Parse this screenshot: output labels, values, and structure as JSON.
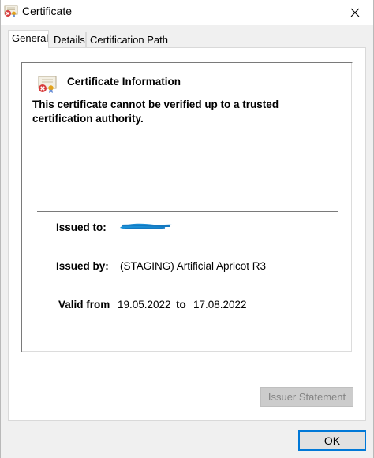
{
  "window": {
    "title": "Certificate",
    "close_symbol": "✕"
  },
  "tabs": [
    {
      "label": "General"
    },
    {
      "label": "Details"
    },
    {
      "label": "Certification Path"
    }
  ],
  "info": {
    "heading": "Certificate Information",
    "warning": "This certificate cannot be verified up to a trusted certification authority.",
    "issued_to_label": "Issued to:",
    "issued_by_label": "Issued by:",
    "issued_by_value": "(STAGING) Artificial Apricot R3",
    "valid_from_label": "Valid from",
    "valid_from_value": "19.05.2022",
    "to_label": "to",
    "valid_to_value": "17.08.2022"
  },
  "buttons": {
    "issuer_statement": "Issuer Statement",
    "ok": "OK"
  },
  "colors": {
    "accent": "#0078d7",
    "redaction": "#1a8fd6",
    "error_red": "#d83b3b"
  },
  "icons": {
    "title_icon": "certificate-error-icon",
    "close_icon": "close-icon",
    "info_icon": "certificate-error-icon"
  }
}
